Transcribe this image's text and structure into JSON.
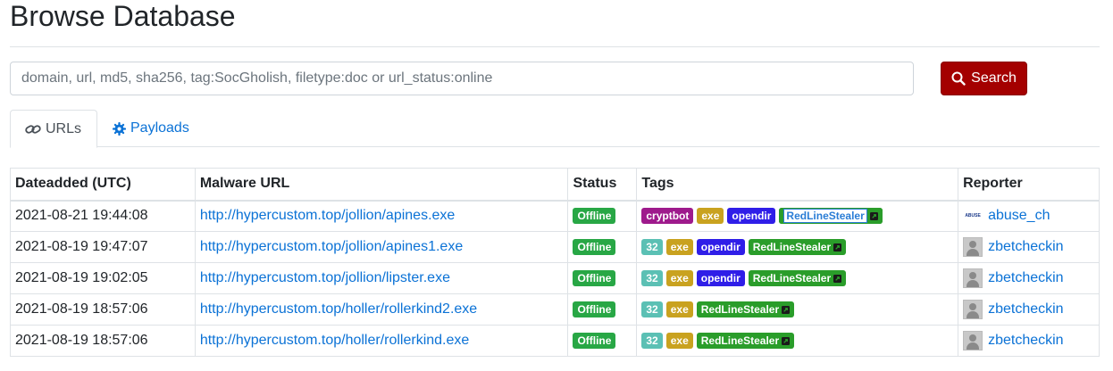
{
  "page": {
    "title": "Browse Database"
  },
  "search": {
    "placeholder": "domain, url, md5, sha256, tag:SocGholish, filetype:doc or url_status:online",
    "button_label": "Search"
  },
  "tabs": [
    {
      "label": "URLs",
      "icon": "link-icon",
      "active": true
    },
    {
      "label": "Payloads",
      "icon": "gear-icon",
      "active": false
    }
  ],
  "table": {
    "headers": [
      "Dateadded (UTC)",
      "Malware URL",
      "Status",
      "Tags",
      "Reporter"
    ],
    "rows": [
      {
        "date": "2021-08-21 19:44:08",
        "url": "http://hypercustom.top/jollion/apines.exe",
        "status": "Offline",
        "tags": [
          "cryptbot",
          "exe",
          "opendir",
          "RedLineStealer"
        ],
        "reporter": "abuse_ch",
        "reporter_logo": "ABUSE"
      },
      {
        "date": "2021-08-19 19:47:07",
        "url": "http://hypercustom.top/jollion/apines1.exe",
        "status": "Offline",
        "tags": [
          "32",
          "exe",
          "opendir",
          "RedLineStealer"
        ],
        "reporter": "zbetcheckin"
      },
      {
        "date": "2021-08-19 19:02:05",
        "url": "http://hypercustom.top/jollion/lipster.exe",
        "status": "Offline",
        "tags": [
          "32",
          "exe",
          "opendir",
          "RedLineStealer"
        ],
        "reporter": "zbetcheckin"
      },
      {
        "date": "2021-08-19 18:57:06",
        "url": "http://hypercustom.top/holler/rollerkind2.exe",
        "status": "Offline",
        "tags": [
          "32",
          "exe",
          "RedLineStealer"
        ],
        "reporter": "zbetcheckin"
      },
      {
        "date": "2021-08-19 18:57:06",
        "url": "http://hypercustom.top/holler/rollerkind.exe",
        "status": "Offline",
        "tags": [
          "32",
          "exe",
          "RedLineStealer"
        ],
        "reporter": "zbetcheckin"
      }
    ]
  },
  "colors": {
    "search_button": "#a40000",
    "link": "#0b72d6",
    "status_offline": "#28a745",
    "tag_32": "#5bc0b4",
    "tag_cryptbot": "#9e1a8c",
    "tag_exe": "#c9a21f",
    "tag_opendir": "#2f1ee8",
    "tag_redline": "#2a9d2a"
  }
}
